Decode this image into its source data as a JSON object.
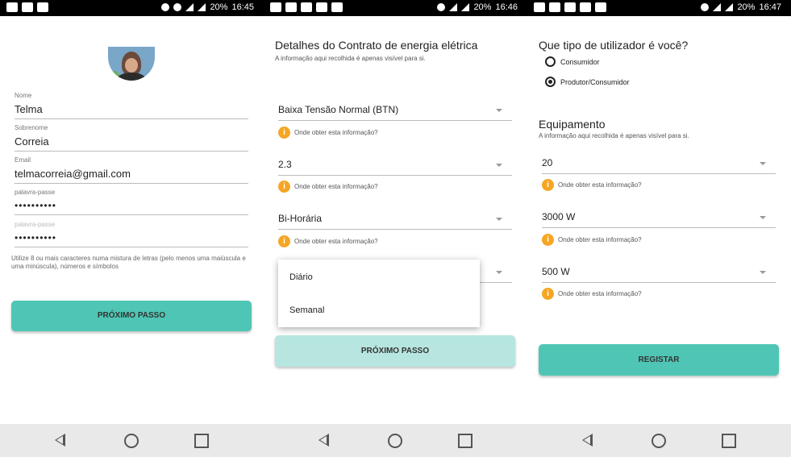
{
  "status": {
    "s1": {
      "battery": "20%",
      "time": "16:45"
    },
    "s2": {
      "battery": "20%",
      "time": "16:46"
    },
    "s3": {
      "battery": "20%",
      "time": "16:47"
    }
  },
  "screen1": {
    "fields": [
      {
        "label": "Nome",
        "value": "Telma"
      },
      {
        "label": "Sobrenome",
        "value": "Correia"
      },
      {
        "label": "Email",
        "value": "telmacorreia@gmail.com"
      },
      {
        "label": "palavra-passe",
        "value": "••••••••••"
      },
      {
        "label": "palavra-passe",
        "value": "••••••••••"
      }
    ],
    "hint": "Utilize 8 ou mais caracteres numa mistura de letras (pelo menos uma maiúscula e uma minúscula), números e símbolos",
    "button": "PRÓXIMO PASSO"
  },
  "screen2": {
    "title": "Detalhes do Contrato de energia elétrica",
    "subtitle": "A informação aqui recolhida é apenas visível para si.",
    "selects": [
      "Baixa Tensão Normal (BTN)",
      "2.3",
      "Bi-Horária"
    ],
    "info_text": "Onde obter esta informação?",
    "dropdown_options": [
      "Diário",
      "Semanal"
    ],
    "button": "PRÓXIMO PASSO"
  },
  "screen3": {
    "title": "Que tipo de utilizador é você?",
    "radios": [
      {
        "label": "Consumidor",
        "selected": false
      },
      {
        "label": "Produtor/Consumidor",
        "selected": true
      }
    ],
    "section_title": "Equipamento",
    "section_subtitle": "A informação aqui recolhida é apenas visível para si.",
    "selects": [
      "20",
      "3000 W",
      "500 W"
    ],
    "info_text": "Onde obter esta informação?",
    "button": "REGISTAR"
  },
  "colors": {
    "accent": "#4fc6b5",
    "accent_disabled": "#b6e6df",
    "info": "#f5a623"
  }
}
